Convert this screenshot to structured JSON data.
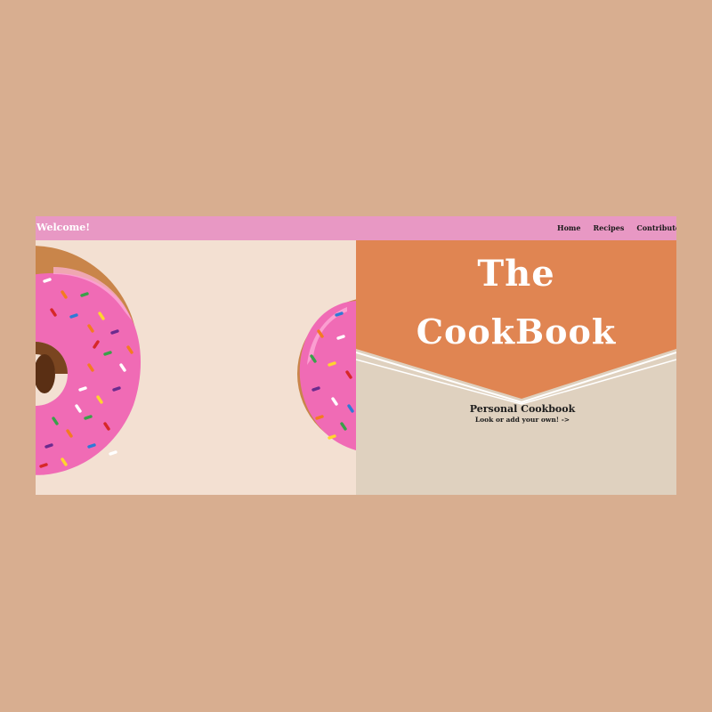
{
  "navbar": {
    "welcome": "Welcome!",
    "links": [
      "Home",
      "Recipes",
      "Contribute"
    ]
  },
  "hero": {
    "title_line1": "The",
    "title_line2": "CookBook",
    "subtitle": "Personal Cookbook",
    "tagline": "Look or add your own! ->"
  },
  "colors": {
    "page_background": "#d8ae90",
    "navbar": "#e898c4",
    "banner_orange": "#e08552",
    "panel_beige": "#dfd1bf",
    "photo_background": "#f3e0d2",
    "donut_icing": "#f06bb5"
  },
  "images": {
    "hero_photo": "pink-sprinkle-donuts-photo"
  }
}
